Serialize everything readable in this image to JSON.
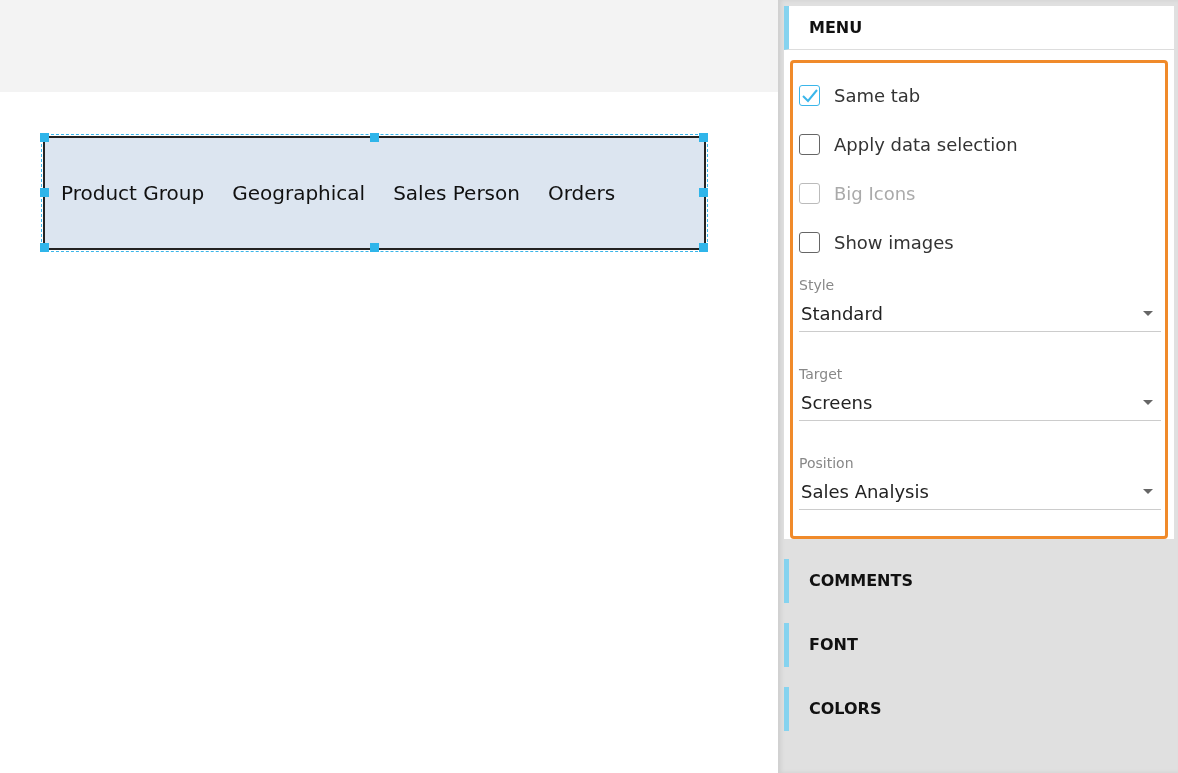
{
  "canvas": {
    "menu_widget": {
      "selected": true,
      "items": [
        {
          "label": "Product Group"
        },
        {
          "label": "Geographical"
        },
        {
          "label": "Sales Person"
        },
        {
          "label": "Orders"
        }
      ]
    }
  },
  "panel": {
    "sections": [
      {
        "title": "MENU",
        "expanded": true,
        "options": [
          {
            "kind": "checkbox",
            "label": "Same tab",
            "checked": true,
            "disabled": false
          },
          {
            "kind": "checkbox",
            "label": "Apply data selection",
            "checked": false,
            "disabled": false
          },
          {
            "kind": "checkbox",
            "label": "Big Icons",
            "checked": false,
            "disabled": true
          },
          {
            "kind": "checkbox",
            "label": "Show images",
            "checked": false,
            "disabled": false
          },
          {
            "kind": "select",
            "label": "Style",
            "value": "Standard"
          },
          {
            "kind": "select",
            "label": "Target",
            "value": "Screens"
          },
          {
            "kind": "select",
            "label": "Position",
            "value": "Sales Analysis"
          }
        ]
      },
      {
        "title": "COMMENTS",
        "expanded": false
      },
      {
        "title": "FONT",
        "expanded": false
      },
      {
        "title": "COLORS",
        "expanded": false
      }
    ]
  }
}
